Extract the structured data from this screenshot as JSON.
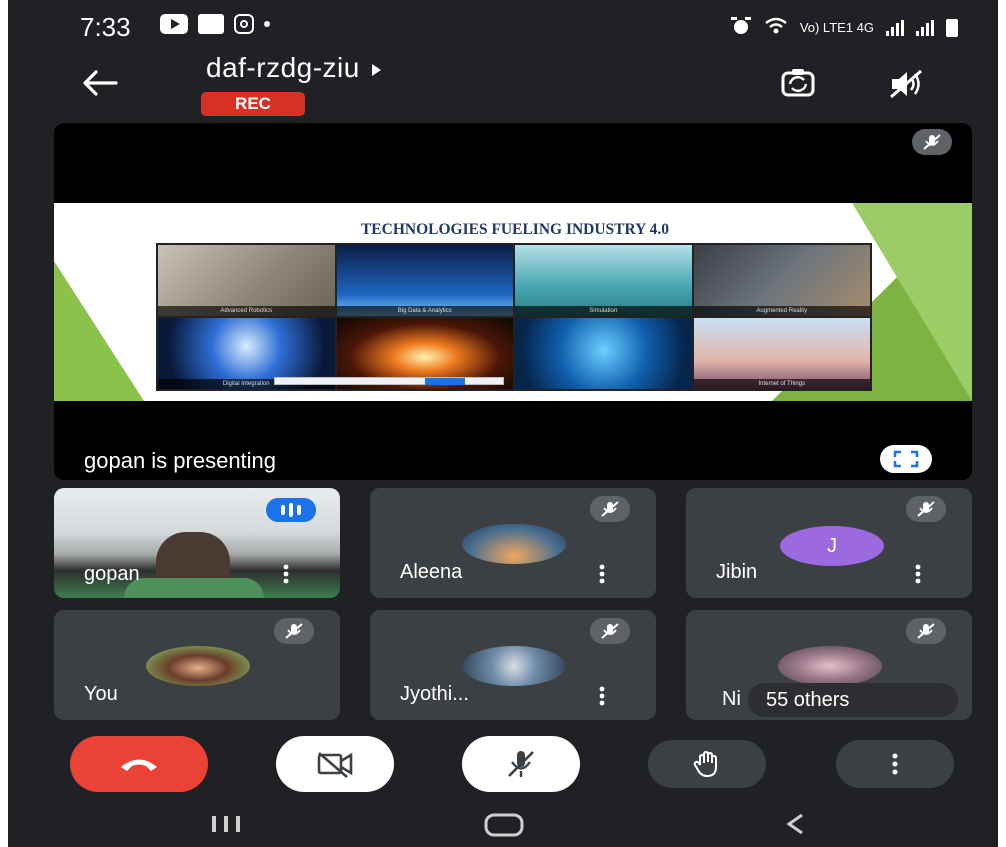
{
  "status_bar": {
    "time": "7:33",
    "network": "Vo) LTE1 4G"
  },
  "header": {
    "meeting_code": "daf-rzdg-ziu",
    "rec_label": "REC"
  },
  "presentation": {
    "slide_title": "TECHNOLOGIES FUELING INDUSTRY 4.0",
    "tiles": [
      "Advanced Robotics",
      "Big Data & Analytics",
      "Simulation",
      "Augmented Reality",
      "Digital Integration",
      "",
      "",
      "Internet of Things"
    ],
    "presenting_label": "gopan is presenting"
  },
  "participants": [
    {
      "name": "gopan",
      "muted": false,
      "speaking": true
    },
    {
      "name": "Aleena",
      "muted": true
    },
    {
      "name": "Jibin",
      "muted": true,
      "initial": "J"
    },
    {
      "name": "You",
      "muted": true
    },
    {
      "name": "Jyothi...",
      "muted": true
    },
    {
      "name": "Ni",
      "muted": true
    }
  ],
  "others_label": "55 others",
  "colors": {
    "background": "#202124",
    "tile": "#3c4043",
    "rec": "#d93025",
    "end_call": "#ea4335",
    "speaking": "#1a73e8",
    "jibin_avatar": "#9c6ade"
  },
  "controls": [
    "end-call",
    "camera-off",
    "mic-off",
    "raise-hand",
    "more-options"
  ]
}
